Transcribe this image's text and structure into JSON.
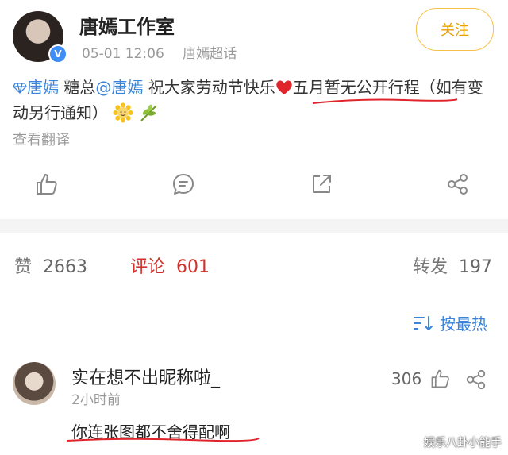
{
  "post": {
    "author": "唐嫣工作室",
    "time": "05-01 12:06",
    "source": "唐嫣超话",
    "follow_label": "关注",
    "tag_link": "唐嫣",
    "text_a": " 糖总",
    "mention": "@唐嫣",
    "text_b": " 祝大家劳动节快乐",
    "text_highlight": "五月暂无公开行程",
    "text_c": "（如有变动另行通知）",
    "translate_label": "查看翻译"
  },
  "stats": {
    "likes_label": "赞",
    "likes": "2663",
    "comments_label": "评论",
    "comments": "601",
    "reposts_label": "转发",
    "reposts": "197"
  },
  "sort_label": "按最热",
  "comment": {
    "name": "实在想不出昵称啦_",
    "time": "2小时前",
    "likes": "306",
    "text": "你连张图都不舍得配啊"
  },
  "watermark": "娱乐八卦小能手",
  "colors": {
    "accent_red": "#d0312d",
    "link_blue": "#3c84d8",
    "follow_gold": "#f6c04a"
  }
}
